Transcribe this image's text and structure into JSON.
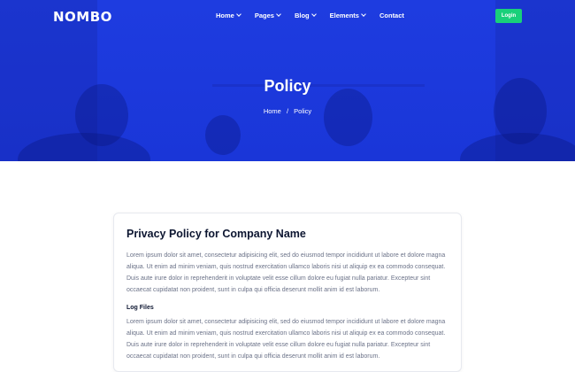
{
  "brand": {
    "logo": "NOMBO"
  },
  "nav": {
    "items": [
      {
        "label": "Home",
        "has_dropdown": true
      },
      {
        "label": "Pages",
        "has_dropdown": true
      },
      {
        "label": "Blog",
        "has_dropdown": true
      },
      {
        "label": "Elements",
        "has_dropdown": true
      },
      {
        "label": "Contact",
        "has_dropdown": false
      }
    ],
    "login_label": "Login"
  },
  "hero": {
    "title": "Policy",
    "breadcrumb": {
      "home": "Home",
      "separator": "/",
      "current": "Policy"
    }
  },
  "content": {
    "title": "Privacy Policy for Company Name",
    "paragraph1": "Lorem ipsum dolor sit amet, consectetur adipisicing elit, sed do eiusmod tempor incididunt ut labore et dolore magna aliqua. Ut enim ad minim veniam, quis nostrud exercitation ullamco laboris nisi ut aliquip ex ea commodo consequat. Duis aute irure dolor in reprehenderit in voluptate velit esse cillum dolore eu fugiat nulla pariatur. Excepteur sint occaecat cupidatat non proident, sunt in culpa qui officia deserunt mollit anim id est laborum.",
    "section_title": "Log Files",
    "paragraph2": "Lorem ipsum dolor sit amet, consectetur adipisicing elit, sed do eiusmod tempor incididunt ut labore et dolore magna aliqua. Ut enim ad minim veniam, quis nostrud exercitation ullamco laboris nisi ut aliquip ex ea commodo consequat. Duis aute irure dolor in reprehenderit in voluptate velit esse cillum dolore eu fugiat nulla pariatur. Excepteur sint occaecat cupidatat non proident, sunt in culpa qui officia deserunt mollit anim id est laborum."
  },
  "colors": {
    "hero_overlay": "#1e3ce0",
    "accent_button": "#19d07a",
    "heading": "#0d1631",
    "body_text": "#6b7288"
  }
}
